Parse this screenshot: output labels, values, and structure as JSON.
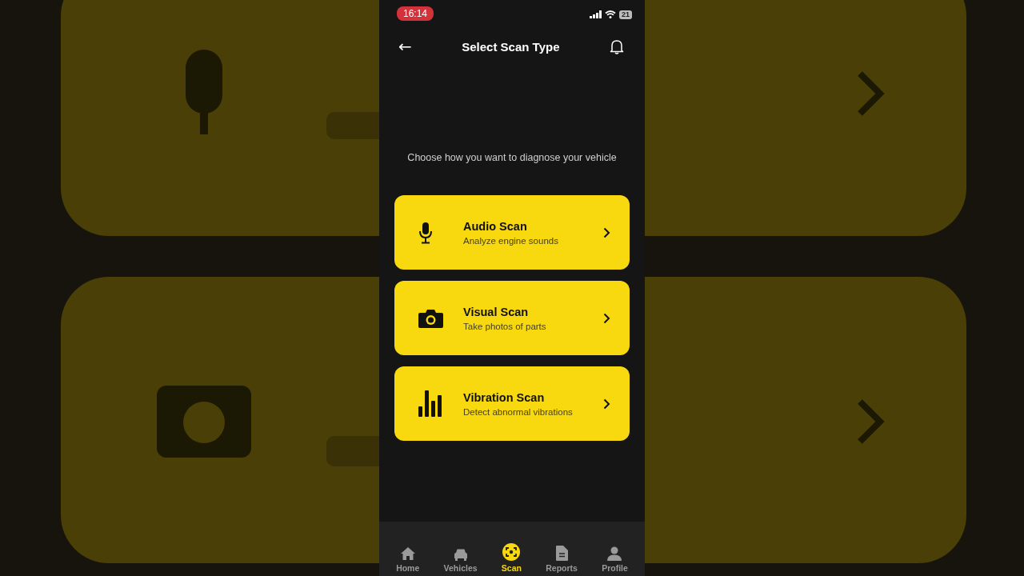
{
  "status_bar": {
    "time": "16:14",
    "battery": "21"
  },
  "header": {
    "back": "←",
    "title": "Select Scan Type"
  },
  "subtitle": "Choose how you want to diagnose your vehicle",
  "options": [
    {
      "kind": "mic",
      "title": "Audio Scan",
      "description": "Analyze engine sounds"
    },
    {
      "kind": "camera",
      "title": "Visual Scan",
      "description": "Take photos of parts"
    },
    {
      "kind": "bars",
      "title": "Vibration Scan",
      "description": "Detect abnormal vibrations"
    }
  ],
  "tab_bar": [
    {
      "kind": "home",
      "label": "Home",
      "selected": false
    },
    {
      "kind": "car",
      "label": "Vehicles",
      "selected": false
    },
    {
      "kind": "scan",
      "label": "Scan",
      "selected": true
    },
    {
      "kind": "doc",
      "label": "Reports",
      "selected": false
    },
    {
      "kind": "person",
      "label": "Profile",
      "selected": false
    }
  ]
}
